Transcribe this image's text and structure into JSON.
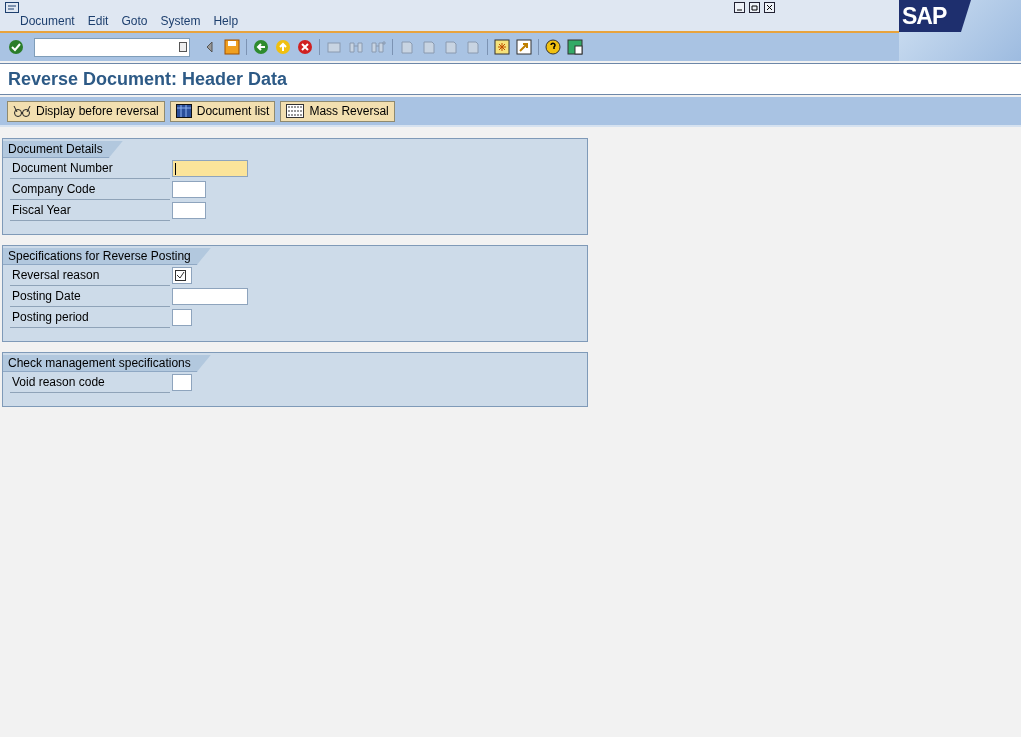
{
  "menu": [
    "Document",
    "Edit",
    "Goto",
    "System",
    "Help"
  ],
  "logo": "SAP",
  "title": "Reverse Document: Header Data",
  "app_buttons": [
    {
      "label": "Display before reversal",
      "kind": "glasses"
    },
    {
      "label": "Document list",
      "kind": "list"
    },
    {
      "label": "Mass Reversal",
      "kind": "mass"
    }
  ],
  "groups": [
    {
      "title": "Document Details",
      "fields": [
        {
          "label": "Document Number",
          "kind": "focused"
        },
        {
          "label": "Company Code",
          "kind": "plain"
        },
        {
          "label": "Fiscal Year",
          "kind": "plain"
        }
      ]
    },
    {
      "title": "Specifications for Reverse Posting",
      "fields": [
        {
          "label": "Reversal reason",
          "kind": "required"
        },
        {
          "label": "Posting Date",
          "kind": "plain"
        },
        {
          "label": "Posting period",
          "kind": "plain"
        }
      ]
    },
    {
      "title": "Check management specifications",
      "fields": [
        {
          "label": "Void reason code",
          "kind": "plain"
        }
      ]
    }
  ]
}
